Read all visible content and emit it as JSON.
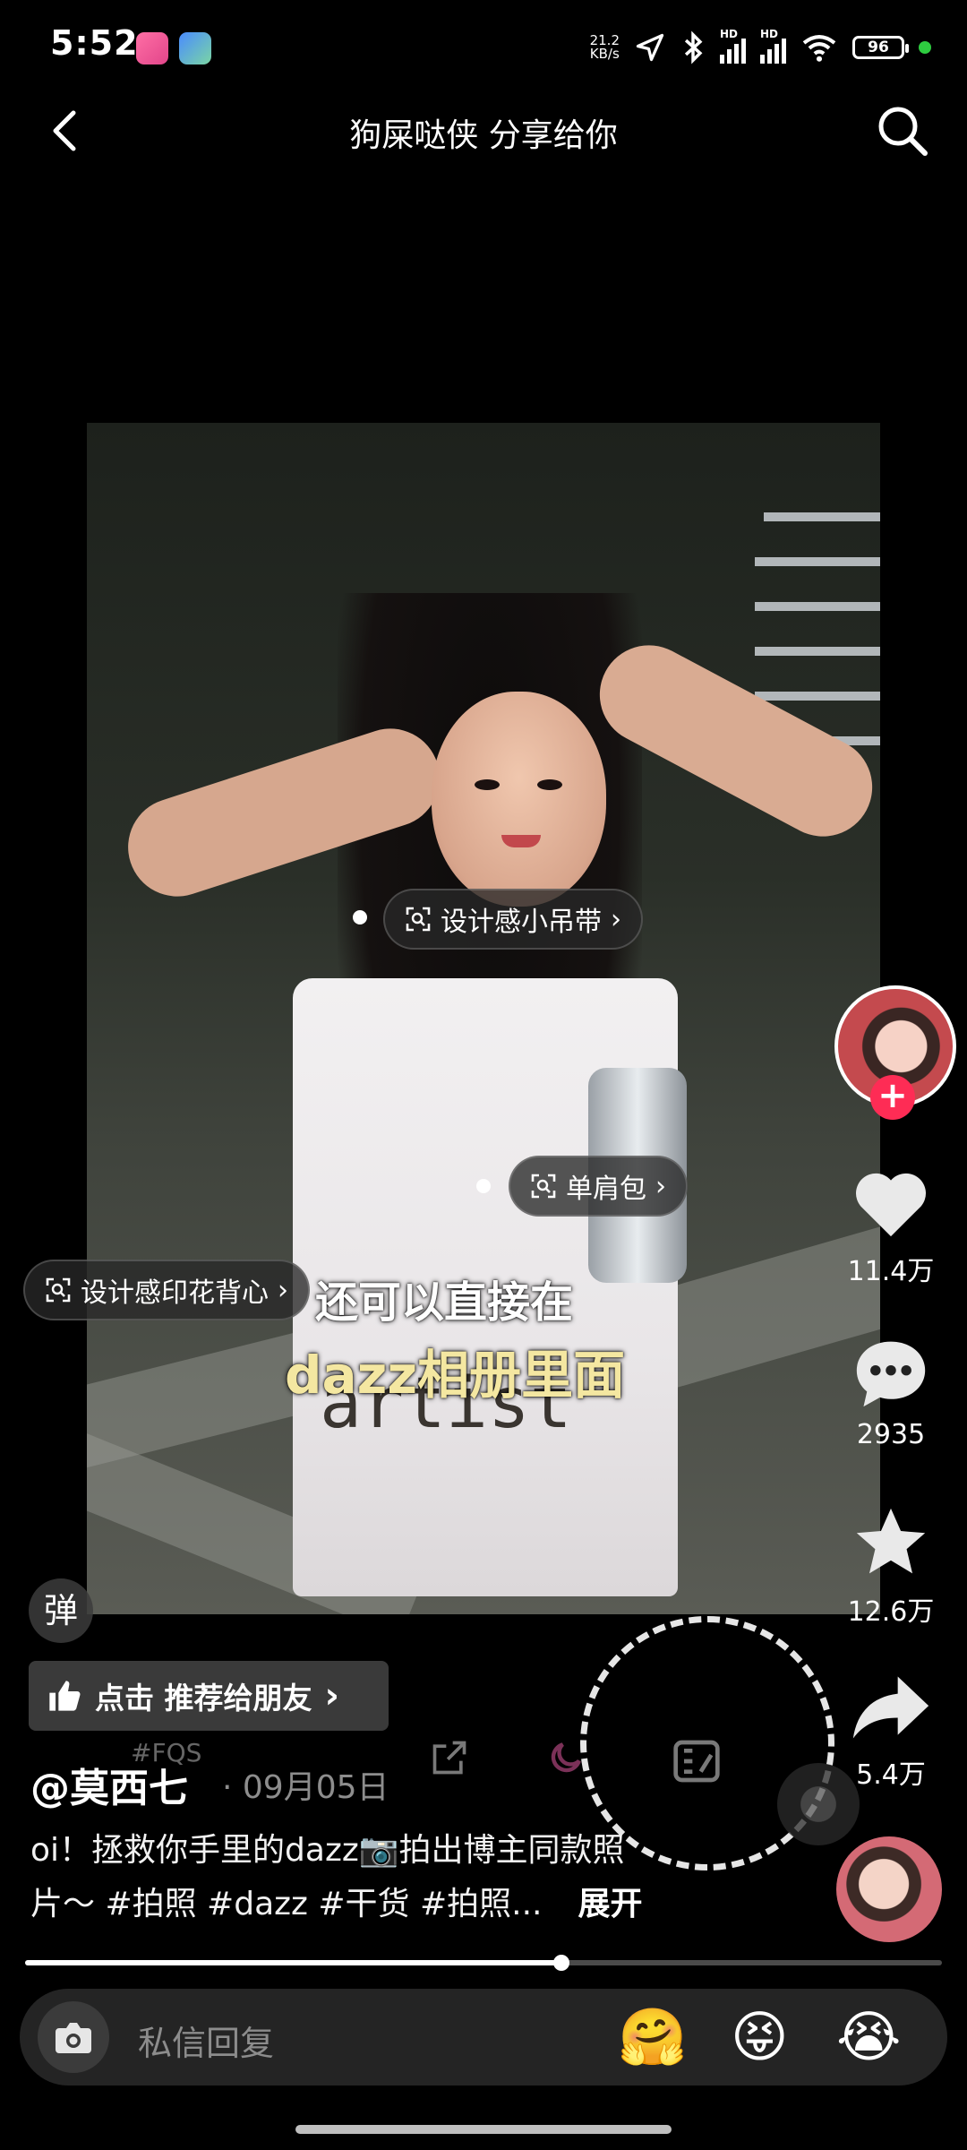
{
  "status_bar": {
    "time": "5:52",
    "net_speed_value": "21.2",
    "net_speed_unit": "KB/s",
    "signal_label_1": "HD",
    "signal_label_2": "HD",
    "battery": "96"
  },
  "header": {
    "title": "狗屎哒侠 分享给你"
  },
  "tags": [
    {
      "label": "设计感小吊带"
    },
    {
      "label": "单肩包"
    },
    {
      "label": "设计感印花背心"
    }
  ],
  "photo": {
    "shirt_print": "artist"
  },
  "subtitles": {
    "line1": "还可以直接在",
    "line2": "dazz相册里面"
  },
  "rail": {
    "likes": "11.4万",
    "comments": "2935",
    "favorites": "12.6万",
    "shares": "5.4万"
  },
  "danmaku_label": "弹",
  "recommend": {
    "label": "点击 推荐给朋友"
  },
  "post": {
    "author": "@莫西七",
    "date": "09月05日",
    "caption_line1": "oi！拯救你手里的dazz📷拍出博主同款照",
    "caption_line2": "片～ #拍照 #dazz #干货 #拍照...",
    "expand": "展开"
  },
  "ghost_toolbar_label": "#FQS",
  "progress": {
    "fraction": 0.585
  },
  "reply": {
    "placeholder": "私信回复",
    "emojis": [
      "🤗",
      "😝",
      "😭"
    ]
  },
  "colors": {
    "accent": "#fe2c55",
    "subtitle_yellow": "#f4e7a1",
    "background": "#000000"
  }
}
